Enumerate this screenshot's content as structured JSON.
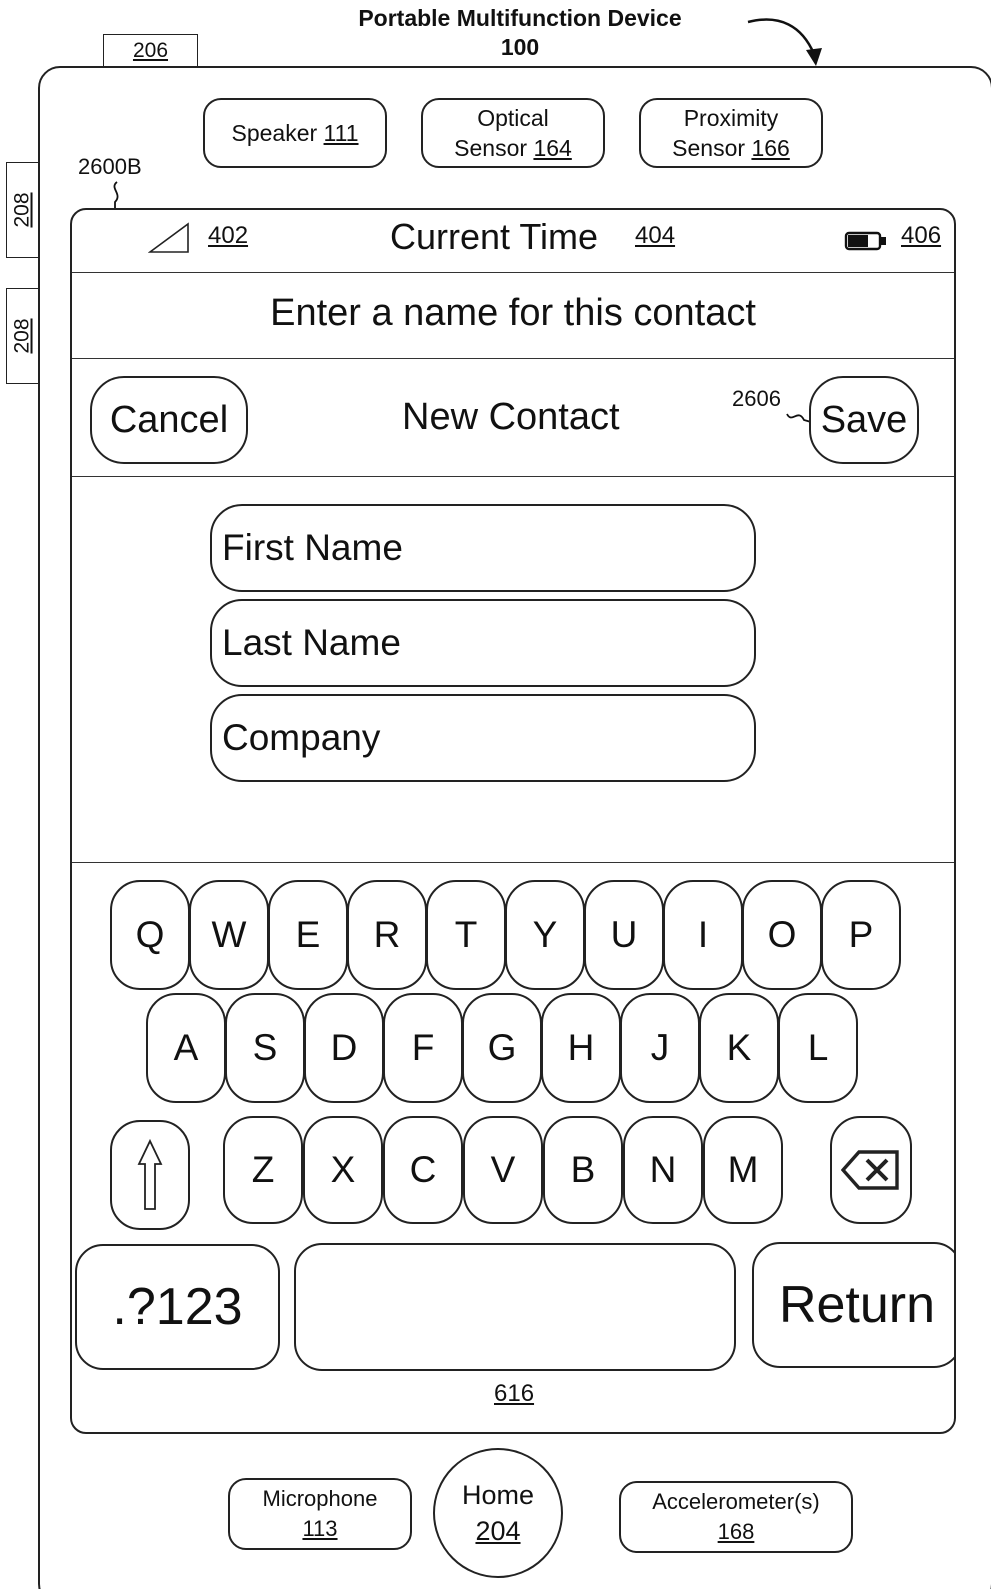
{
  "title": {
    "line1": "Portable Multifunction Device",
    "line2": "100"
  },
  "side_labels": {
    "top_button": "206",
    "side_button_1": "208",
    "side_button_2": "208"
  },
  "sensors": {
    "speaker": {
      "label": "Speaker",
      "ref": "111"
    },
    "optical": {
      "line1": "Optical",
      "label": "Sensor",
      "ref": "164"
    },
    "proximity": {
      "line1": "Proximity",
      "label": "Sensor",
      "ref": "166"
    }
  },
  "screen_ref": "2600B",
  "status_bar": {
    "signal_ref": "402",
    "time_label": "Current Time",
    "time_ref": "404",
    "battery_ref": "406"
  },
  "prompt": "Enter a name for this contact",
  "nav": {
    "cancel_label": "Cancel",
    "title": "New Contact",
    "save_ref": "2606",
    "save_label": "Save"
  },
  "fields": {
    "first_name": "First Name",
    "last_name": "Last Name",
    "company": "Company"
  },
  "keyboard": {
    "row1": [
      "Q",
      "W",
      "E",
      "R",
      "T",
      "Y",
      "U",
      "I",
      "O",
      "P"
    ],
    "row2": [
      "A",
      "S",
      "D",
      "F",
      "G",
      "H",
      "J",
      "K",
      "L"
    ],
    "row3": [
      "Z",
      "X",
      "C",
      "V",
      "B",
      "N",
      "M"
    ],
    "symbols_label": ".?123",
    "return_label": "Return",
    "shift_icon": "shift-arrow-icon",
    "delete_icon": "backspace-icon"
  },
  "keyboard_ref": "616",
  "bottom": {
    "microphone": {
      "label": "Microphone",
      "ref": "113"
    },
    "home": {
      "label": "Home",
      "ref": "204"
    },
    "accelerometer": {
      "label": "Accelerometer(s)",
      "ref": "168"
    }
  }
}
